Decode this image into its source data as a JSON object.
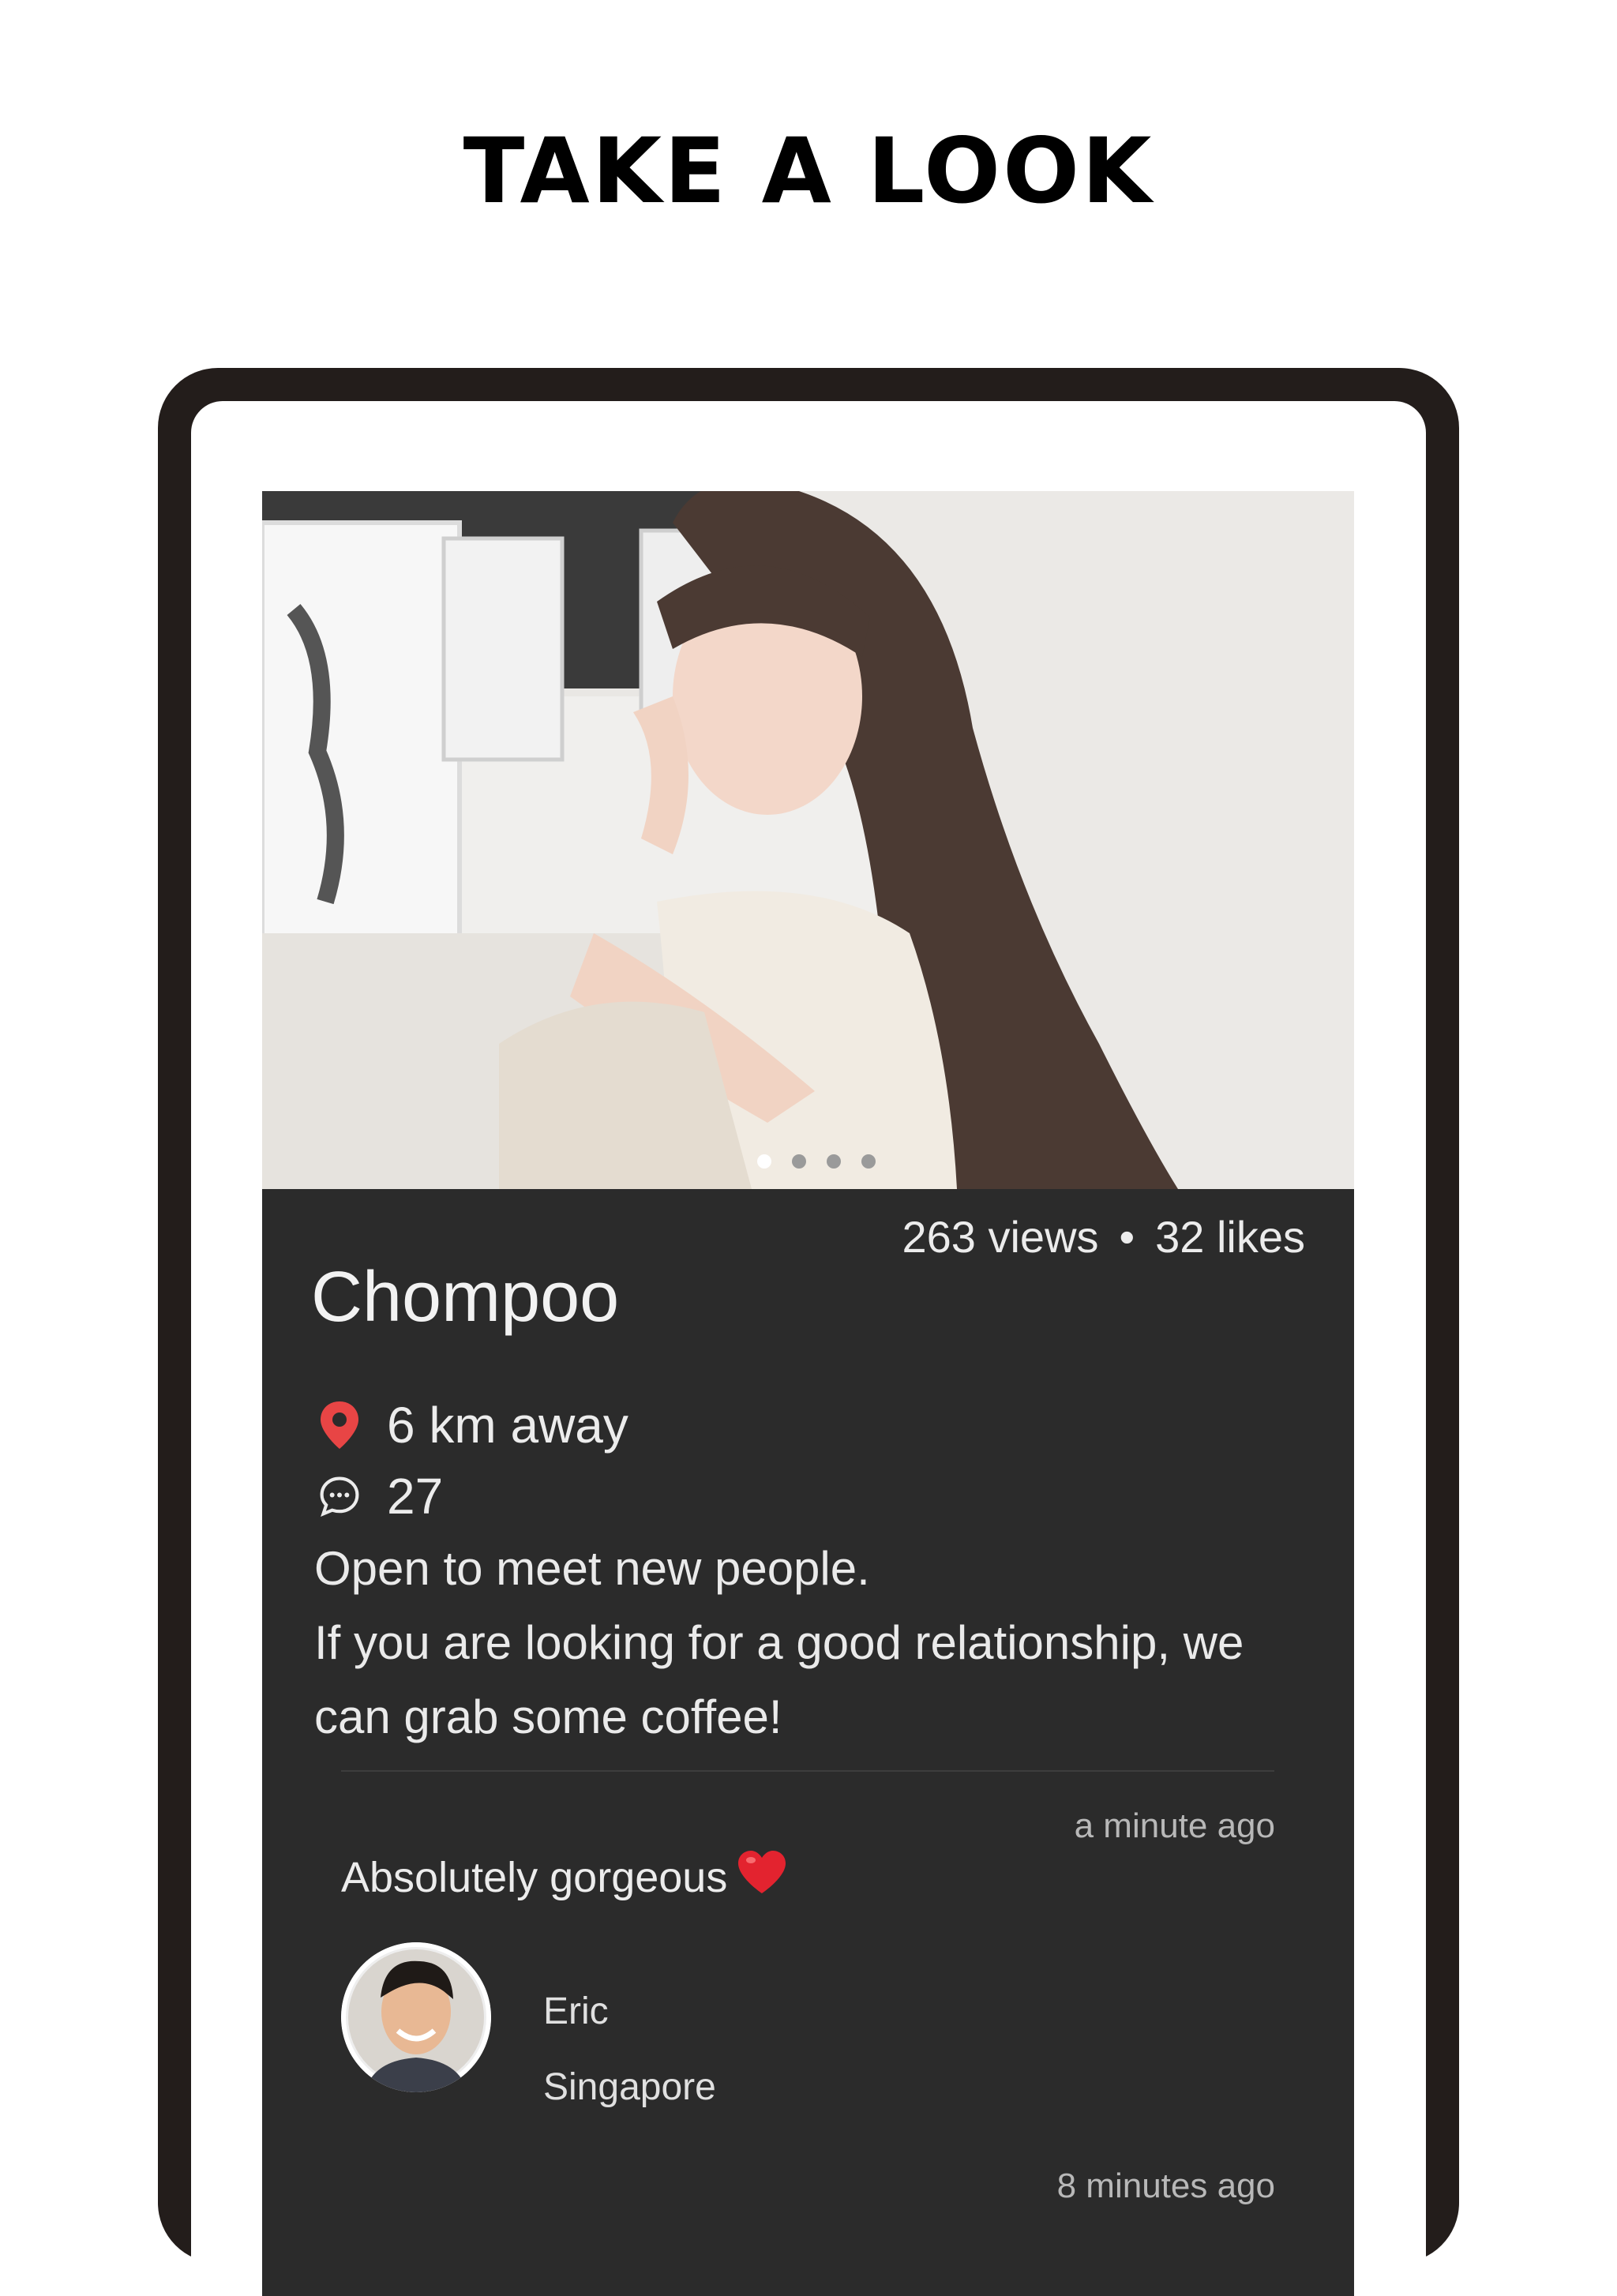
{
  "headline": "TAKE A LOOK",
  "profile": {
    "photo_count": 4,
    "active_photo_index": 0,
    "views": "263 views",
    "separator": "•",
    "likes": "32 likes",
    "name": "Chompoo",
    "distance": "6 km away",
    "comments_count": "27",
    "bio_line1": "Open to meet new people.",
    "bio_line2": "If you are looking for a good relationship, we can grab some coffee!"
  },
  "comments": [
    {
      "time": "a minute ago",
      "text": "Absolutely gorgeous",
      "emoji": "heart",
      "author": "Eric",
      "location": "Singapore"
    }
  ],
  "next_comment_time": "8 minutes ago",
  "colors": {
    "frame": "#231d1b",
    "panel": "#2b2b2b",
    "pin": "#e84545",
    "heart": "#e3232f"
  }
}
